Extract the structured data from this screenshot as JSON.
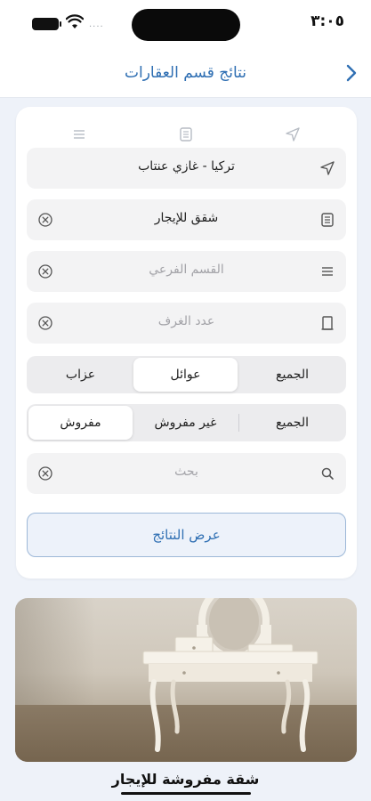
{
  "status_bar": {
    "time": "٣:٠٥",
    "signal": "...."
  },
  "nav": {
    "title": "نتائج قسم العقارات"
  },
  "filters": {
    "location": "تركيا - غازي عنتاب",
    "category": "شقق للإيجار",
    "subcategory_placeholder": "القسم الفرعي",
    "rooms_placeholder": "عدد الغرف",
    "search_placeholder": "بحث"
  },
  "family_segment": {
    "options": [
      "الجميع",
      "عوائل",
      "عزاب"
    ],
    "selected": "عوائل"
  },
  "furnish_segment": {
    "options": [
      "الجميع",
      "غير مفروش",
      "مفروش"
    ],
    "selected": "مفروش"
  },
  "show_results_label": "عرض النتائج",
  "listing": {
    "title": "شقة مفروشة للإيجار"
  },
  "colors": {
    "accent": "#2f6fb3",
    "background": "#eef2f9",
    "field": "#f3f3f4"
  }
}
